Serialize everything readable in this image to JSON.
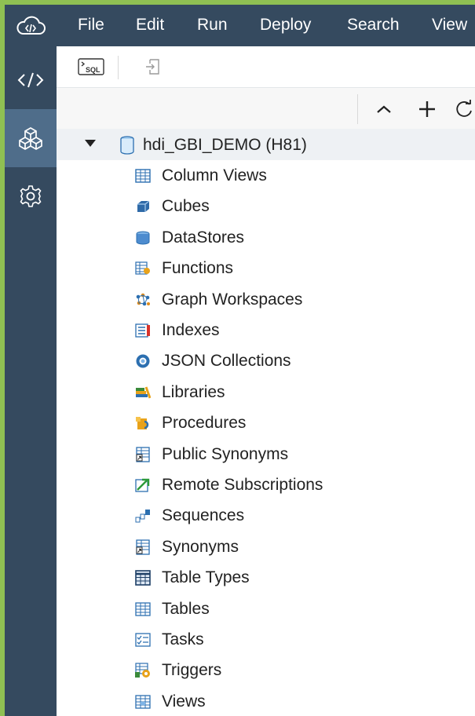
{
  "menubar": {
    "logo_icon": "cloud-code-icon",
    "items": [
      "File",
      "Edit",
      "Run",
      "Deploy",
      "Search",
      "View"
    ]
  },
  "rail": {
    "items": [
      {
        "icon": "code-icon",
        "active": false
      },
      {
        "icon": "database-explorer-icon",
        "active": true
      },
      {
        "icon": "gear-icon",
        "active": false
      }
    ]
  },
  "toolbar": {
    "sql_console_label": "SQL",
    "import_icon": "import-icon"
  },
  "treebar": {
    "collapse_icon": "chevron-up-icon",
    "add_icon": "plus-icon",
    "refresh_icon": "refresh-icon"
  },
  "tree": {
    "root": {
      "label": "hdi_GBI_DEMO (H81)",
      "expanded": true
    },
    "items": [
      {
        "label": "Column Views",
        "icon": "column-views-icon"
      },
      {
        "label": "Cubes",
        "icon": "cubes-icon"
      },
      {
        "label": "DataStores",
        "icon": "datastores-icon"
      },
      {
        "label": "Functions",
        "icon": "functions-icon"
      },
      {
        "label": "Graph Workspaces",
        "icon": "graph-workspaces-icon"
      },
      {
        "label": "Indexes",
        "icon": "indexes-icon"
      },
      {
        "label": "JSON Collections",
        "icon": "json-collections-icon"
      },
      {
        "label": "Libraries",
        "icon": "libraries-icon"
      },
      {
        "label": "Procedures",
        "icon": "procedures-icon"
      },
      {
        "label": "Public Synonyms",
        "icon": "public-synonyms-icon"
      },
      {
        "label": "Remote Subscriptions",
        "icon": "remote-subscriptions-icon"
      },
      {
        "label": "Sequences",
        "icon": "sequences-icon"
      },
      {
        "label": "Synonyms",
        "icon": "synonyms-icon"
      },
      {
        "label": "Table Types",
        "icon": "table-types-icon"
      },
      {
        "label": "Tables",
        "icon": "tables-icon"
      },
      {
        "label": "Tasks",
        "icon": "tasks-icon"
      },
      {
        "label": "Triggers",
        "icon": "triggers-icon"
      },
      {
        "label": "Views",
        "icon": "views-icon"
      }
    ]
  },
  "colors": {
    "shell": "#354a5f",
    "rail_active": "#4f6d8a",
    "frame_border": "#8fc053",
    "selected_row": "#eef1f4"
  }
}
